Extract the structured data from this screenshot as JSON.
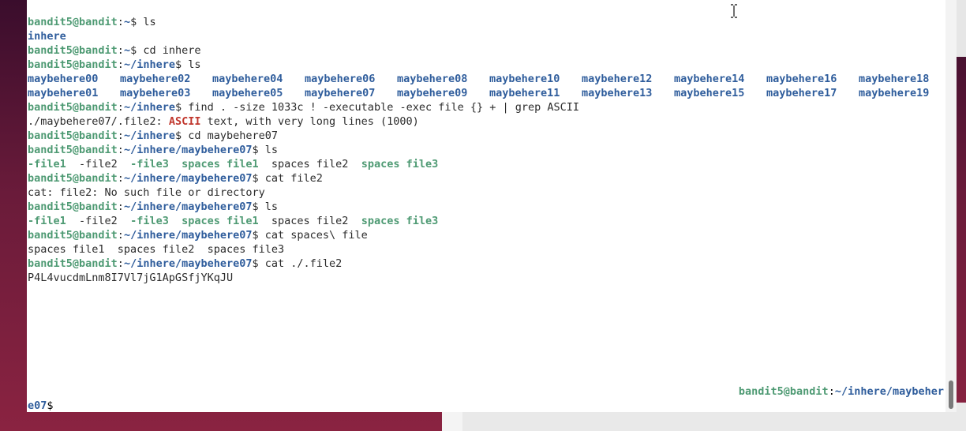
{
  "prompt": {
    "user_host": "bandit5@bandit",
    "sep": ":",
    "sym": "$"
  },
  "lines": [
    {
      "path": "~",
      "cmd": " ls"
    },
    {
      "output_dir": "inhere"
    },
    {
      "path": "~",
      "cmd": " cd inhere"
    },
    {
      "path": "~/inhere",
      "cmd": " ls"
    },
    {
      "dirs": [
        "maybehere00",
        "maybehere02",
        "maybehere04",
        "maybehere06",
        "maybehere08",
        "maybehere10",
        "maybehere12",
        "maybehere14",
        "maybehere16",
        "maybehere18"
      ]
    },
    {
      "dirs": [
        "maybehere01",
        "maybehere03",
        "maybehere05",
        "maybehere07",
        "maybehere09",
        "maybehere11",
        "maybehere13",
        "maybehere15",
        "maybehere17",
        "maybehere19"
      ]
    },
    {
      "path": "~/inhere",
      "cmd": " find . -size 1033c ! -executable -exec file {} + | grep ASCII"
    },
    {
      "pre": "./maybehere07/.file2: ",
      "match": "ASCII",
      "post": " text, with very long lines (1000)"
    },
    {
      "path": "~/inhere",
      "cmd": " cd maybehere07"
    },
    {
      "path": "~/inhere/maybehere07",
      "cmd": " ls"
    },
    {
      "files": [
        {
          "text": "-file1",
          "exec": true
        },
        {
          "text": "  -file2",
          "exec": false
        },
        {
          "text": "  -file3",
          "exec": true
        },
        {
          "text": "  spaces file1",
          "exec": true
        },
        {
          "text": "  spaces file2",
          "exec": false
        },
        {
          "text": "  spaces file3",
          "exec": true
        }
      ]
    },
    {
      "path": "~/inhere/maybehere07",
      "cmd": " cat file2"
    },
    {
      "text": "cat: file2: No such file or directory"
    },
    {
      "path": "~/inhere/maybehere07",
      "cmd": " ls"
    },
    {
      "files": [
        {
          "text": "-file1",
          "exec": true
        },
        {
          "text": "  -file2",
          "exec": false
        },
        {
          "text": "  -file3",
          "exec": true
        },
        {
          "text": "  spaces file1",
          "exec": true
        },
        {
          "text": "  spaces file2",
          "exec": false
        },
        {
          "text": "  spaces file3",
          "exec": true
        }
      ]
    },
    {
      "path": "~/inhere/maybehere07",
      "cmd": " cat spaces\\ file"
    },
    {
      "text": "spaces file1  spaces file2  spaces file3"
    },
    {
      "path": "~/inhere/maybehere07",
      "cmd": " cat ./.file2"
    },
    {
      "text": "P4L4vucdmLnm8I7Vl7jG1ApGSfjYKqJU"
    }
  ],
  "current_prompt": {
    "user_host": "bandit5@bandit",
    "sep": ":",
    "path_part1": "~/inhere/maybeher",
    "path_part2": "e07",
    "sym": "$"
  },
  "colors": {
    "user": "#4e9a73",
    "path": "#2f5d9c",
    "match": "#c0362c",
    "text": "#2b2b2b",
    "terminal_bg": "#ffffff"
  },
  "icons": {
    "cursor": "i-beam-cursor-icon"
  }
}
